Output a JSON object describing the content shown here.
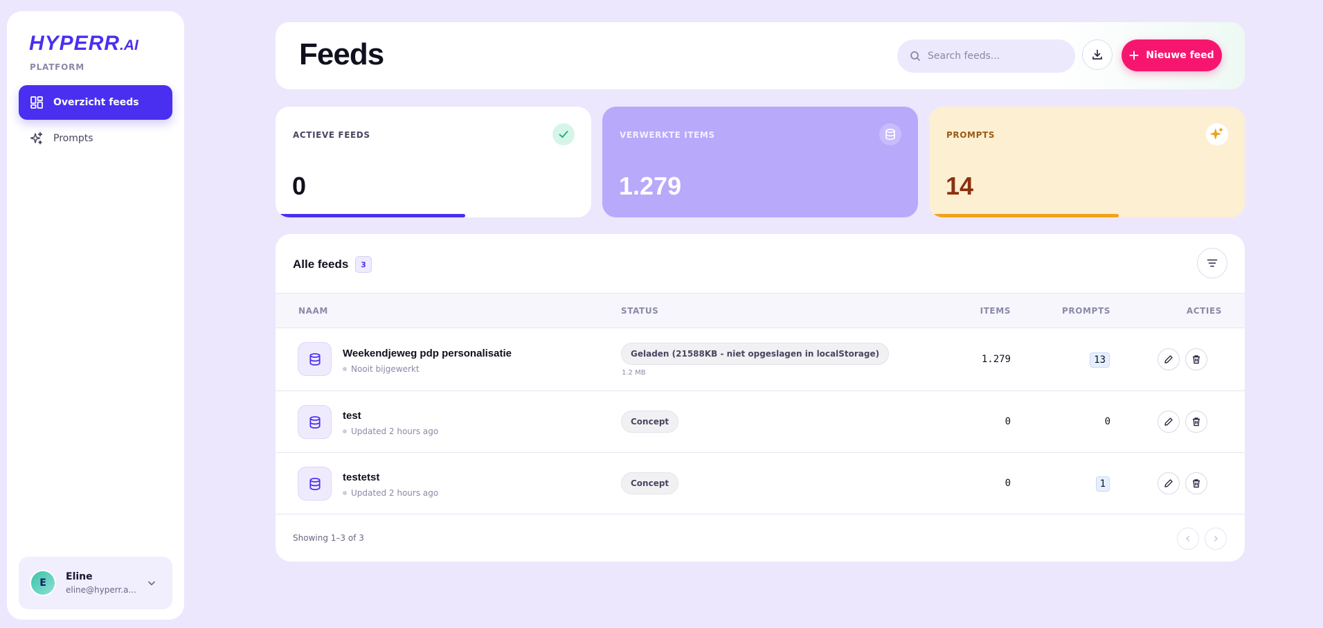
{
  "brand": {
    "name": "HYPERR",
    "suffix": ".AI",
    "section": "PLATFORM"
  },
  "sidebar": {
    "items": [
      {
        "label": "Overzicht feeds",
        "icon": "dashboard-icon",
        "active": true
      },
      {
        "label": "Prompts",
        "icon": "sparkles-icon",
        "active": false
      }
    ]
  },
  "user": {
    "initial": "E",
    "name": "Eline",
    "email": "eline@hyperr.a..."
  },
  "header": {
    "title": "Feeds",
    "search_placeholder": "Search feeds...",
    "new_button": "Nieuwe feed"
  },
  "stats": [
    {
      "label": "ACTIEVE FEEDS",
      "value": "0",
      "icon": "check-icon",
      "progress": 0.6
    },
    {
      "label": "VERWERKTE ITEMS",
      "value": "1.279",
      "icon": "database-icon"
    },
    {
      "label": "PROMPTS",
      "value": "14",
      "icon": "sparkles-icon",
      "progress": 0.6
    }
  ],
  "feeds": {
    "title": "Alle feeds",
    "count": "3",
    "columns": {
      "name": "NAAM",
      "status": "STATUS",
      "items": "ITEMS",
      "prompts": "PROMPTS",
      "actions": "ACTIES"
    },
    "rows": [
      {
        "name": "Weekendjeweg pdp personalisatie",
        "updated": "Nooit bijgewerkt",
        "status": "Geladen (21588KB - niet opgeslagen in localStorage)",
        "size": "1.2 MB",
        "items": "1.279",
        "prompts": "13"
      },
      {
        "name": "test",
        "updated": "Updated 2 hours ago",
        "status": "Concept",
        "items": "0",
        "prompts": "0"
      },
      {
        "name": "testetst",
        "updated": "Updated 2 hours ago",
        "status": "Concept",
        "items": "0",
        "prompts": "1"
      }
    ],
    "footer": "Showing 1–3 of 3"
  },
  "colors": {
    "accent": "#4a2ff0",
    "primary_button": "#f7166f",
    "background": "#ece7fd"
  }
}
